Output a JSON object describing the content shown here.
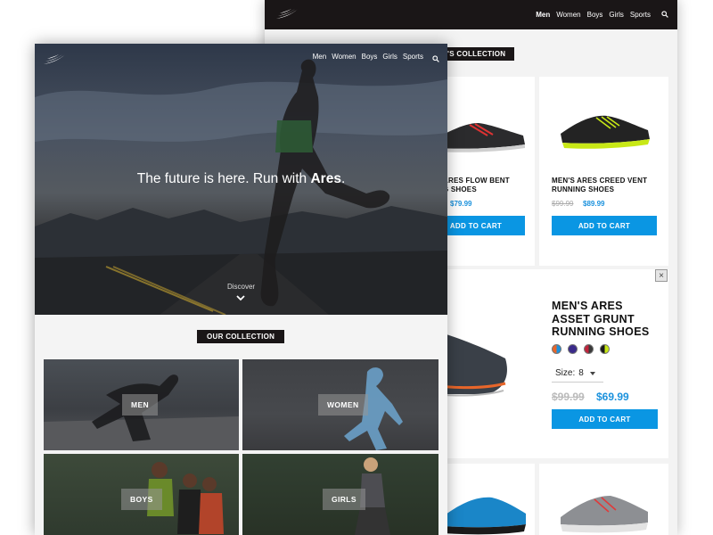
{
  "back_page": {
    "nav": {
      "items": [
        "Men",
        "Women",
        "Boys",
        "Girls",
        "Sports"
      ],
      "active": "Men"
    },
    "section_title_partial": "'S COLLECTION",
    "products": [
      {
        "name_line1": "ARES FLOW BENT",
        "name_line2": "G SHOES",
        "old_price": "",
        "new_price": "$79.99",
        "button": "ADD TO CART"
      },
      {
        "name_line1": "MEN'S ARES CREED VENT",
        "name_line2": "RUNNING SHOES",
        "old_price": "$99.99",
        "new_price": "$89.99",
        "button": "ADD TO CART"
      }
    ],
    "featured": {
      "name_line1": "MEN'S ARES",
      "name_line2": "ASSET GRUNT",
      "name_line3": "RUNNING SHOES",
      "swatch_colors": [
        "#e8662a",
        "#3a2a8a",
        "#c0243c",
        "#1a1a1a"
      ],
      "size_label": "Size:",
      "size_value": "8",
      "old_price": "$99.99",
      "new_price": "$69.99",
      "button": "ADD TO CART",
      "close_icon": "×"
    }
  },
  "front_page": {
    "nav": {
      "items": [
        "Men",
        "Women",
        "Boys",
        "Girls",
        "Sports"
      ]
    },
    "hero": {
      "headline_prefix": "The future is here. Run with ",
      "headline_brand": "Ares",
      "headline_suffix": ".",
      "discover": "Discover"
    },
    "collection_title": "OUR COLLECTION",
    "tiles": [
      {
        "label": "MEN"
      },
      {
        "label": "WOMEN"
      },
      {
        "label": "BOYS"
      },
      {
        "label": "GIRLS"
      }
    ]
  },
  "colors": {
    "nav_dark": "#1a1617",
    "accent_blue": "#0a96e3",
    "price_blue": "#1c92dd"
  },
  "icons": [
    "wing-logo-icon",
    "search-icon",
    "chevron-down-icon",
    "close-icon"
  ]
}
